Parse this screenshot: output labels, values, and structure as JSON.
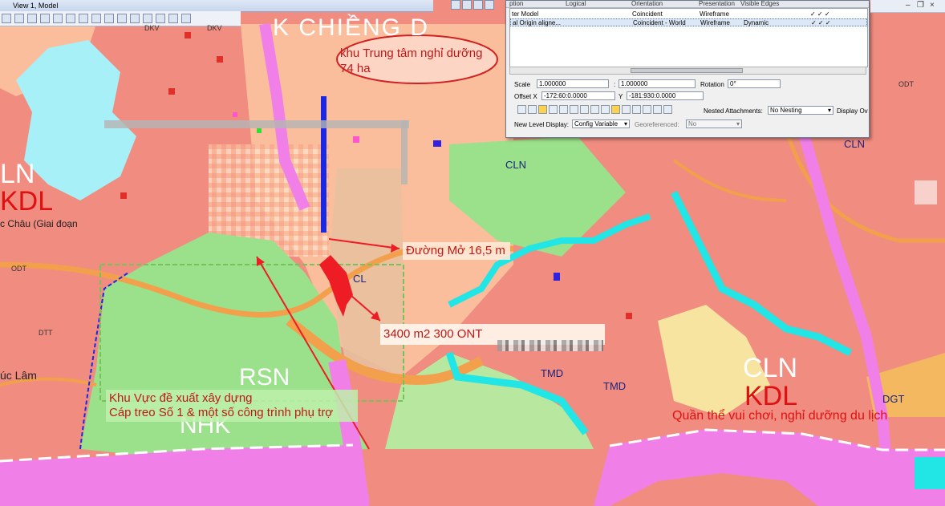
{
  "window": {
    "title": "View 1, Model"
  },
  "dialog": {
    "headers": [
      "ption",
      "Logical",
      "Orientation",
      "Presentation",
      "Visible Edges"
    ],
    "rows": [
      {
        "name": "ter Model",
        "orientation": "Coincident",
        "presentation": "Wireframe",
        "edges": "",
        "checks": "✓  ✓  ✓"
      },
      {
        "name": "al Origin aligne...",
        "orientation": "Coincident - World",
        "presentation": "Wireframe",
        "edges": "Dynamic",
        "checks": "✓  ✓  ✓"
      }
    ],
    "scale_label": "Scale",
    "scale_x": "1.000000",
    "scale_sep": ":",
    "scale_y": "1.000000",
    "rotation_label": "Rotation",
    "rotation_value": "0°",
    "offset_label": "Offset X",
    "offset_x": "-172:60:0.0000",
    "offset_y_label": "Y",
    "offset_y": "-181:930:0.0000",
    "nested_label": "Nested Attachments:",
    "nested_value": "No Nesting",
    "display_label": "Display Ov",
    "new_level_label": "New Level Display:",
    "new_level_value": "Config Variable",
    "georef_label": "Georeferenced:",
    "georef_value": "No"
  },
  "map": {
    "colors": {
      "residential": "#f08c80",
      "tourism": "#fbbe9c",
      "forest": "#9be08a",
      "road": "#f3a04d",
      "pink_boundary": "#f080e8",
      "water": "#a8f0f8",
      "cyan": "#22e5e6",
      "arrow": "#ee1c24"
    },
    "labels": {
      "dkv1": "DKV",
      "dkv2": "DKV",
      "chieng": "K CHIỀNG D",
      "odt_left": "ODT",
      "odt_right": "ODT",
      "dtt": "DTT",
      "ln": "LN",
      "kdl_left": "KDL",
      "chau": "c Châu (Giai đoạn",
      "uc_lam": "úc Lâm",
      "cln_top": "CLN",
      "cln_right": "CLN",
      "cln_big": "CLN",
      "kdl_big": "KDL",
      "cl": "CL",
      "tmd1": "TMD",
      "tmd2": "TMD",
      "dgt": "DGT",
      "rsn": "RSN",
      "nhk": "NHK",
      "quan_the": "Quần thể vui chơi, nghỉ dưỡng du lịch"
    },
    "annotations": {
      "resort_line1": "khu Trung tâm nghỉ dưỡng",
      "resort_line2": "74 ha",
      "road": "Đường Mở 16,5 m",
      "plot": "3400 m2 300 ONT",
      "zone_line1": "Khu Vực đề xuất xây dựng",
      "zone_line2": "Cáp treo Số 1 & một số công trình phụ trợ"
    }
  }
}
